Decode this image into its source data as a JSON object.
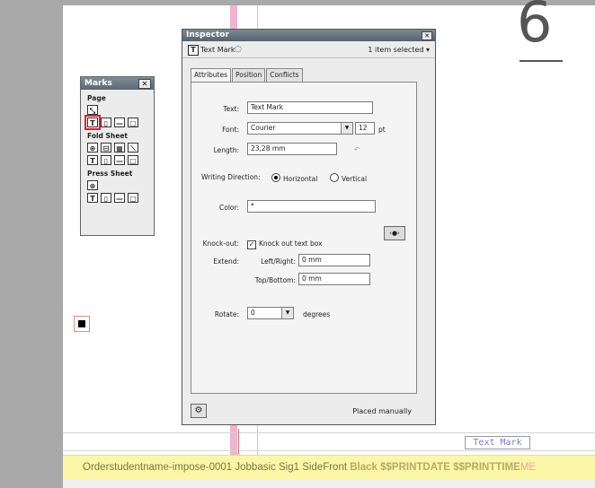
{
  "canvas": {
    "page_number": "6",
    "text_mark_preview": "Text Mark",
    "slug_line": {
      "main": "Orderstudentname-impose-0001 Jobbasic Sig1 SideFront ",
      "bold": "Black $$PRINTDATE $$PRINTTIME",
      "tail": "ME"
    }
  },
  "marks_palette": {
    "title": "Marks",
    "close_label": "✕",
    "sections": [
      {
        "label": "Page"
      },
      {
        "label": "Fold Sheet"
      },
      {
        "label": "Press Sheet"
      }
    ]
  },
  "inspector": {
    "title": "Inspector",
    "close_label": "✕",
    "header": {
      "type_icon": "T",
      "name": "Text Mark",
      "ring_icon": "◌",
      "selection": "1 item selected ▾"
    },
    "tabs": [
      {
        "label": "Attributes"
      },
      {
        "label": "Position"
      },
      {
        "label": "Conflicts"
      }
    ],
    "fields": {
      "text_label": "Text:",
      "text_value": "Text Mark",
      "font_label": "Font:",
      "font_value": "Courier",
      "font_size": "12",
      "font_unit": "pt",
      "length_label": "Length:",
      "length_value": "23,28 mm",
      "length_reset_icon": "↶",
      "writing_direction_label": "Writing Direction:",
      "horizontal_label": "Horizontal",
      "vertical_label": "Vertical",
      "color_label": "Color:",
      "color_value": "*",
      "color_picker_label": "‹●›",
      "knockout_label": "Knock-out:",
      "knockout_check_label": "Knock out text box",
      "extend_label": "Extend:",
      "left_right_label": "Left/Right:",
      "left_right_value": "0 mm",
      "top_bottom_label": "Top/Bottom:",
      "top_bottom_value": "0 mm",
      "rotate_label": "Rotate:",
      "rotate_value": "0",
      "rotate_unit": "degrees"
    },
    "footer": {
      "gear_icon": "⚙",
      "status": "Placed manually"
    }
  }
}
